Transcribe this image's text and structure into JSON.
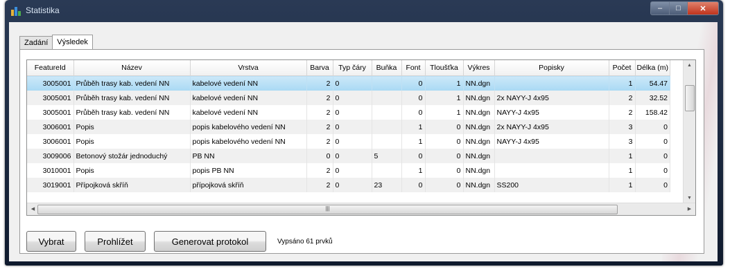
{
  "window": {
    "title": "Statistika",
    "icon": "app-icon"
  },
  "tabs": [
    {
      "label": "Zadání"
    },
    {
      "label": "Výsledek"
    }
  ],
  "table": {
    "columns": [
      "FeatureId",
      "Název",
      "Vrstva",
      "Barva",
      "Typ čáry",
      "Buňka",
      "Font",
      "Tloušťka",
      "Výkres",
      "Popisky",
      "Počet",
      "Délka (m)"
    ],
    "rows": [
      [
        "3005001",
        "Průběh trasy kab. vedení NN",
        "kabelové vedení NN",
        "2",
        "0",
        "",
        "0",
        "1",
        "NN.dgn",
        "",
        "1",
        "54.47"
      ],
      [
        "3005001",
        "Průběh trasy kab. vedení NN",
        "kabelové vedení NN",
        "2",
        "0",
        "",
        "0",
        "1",
        "NN.dgn",
        "2x NAYY-J 4x95",
        "2",
        "32.52"
      ],
      [
        "3005001",
        "Průběh trasy kab. vedení NN",
        "kabelové vedení NN",
        "2",
        "0",
        "",
        "0",
        "1",
        "NN.dgn",
        "NAYY-J 4x95",
        "2",
        "158.42"
      ],
      [
        "3006001",
        "Popis",
        "popis kabelového vedení NN",
        "2",
        "0",
        "",
        "1",
        "0",
        "NN.dgn",
        "2x NAYY-J 4x95",
        "3",
        "0"
      ],
      [
        "3006001",
        "Popis",
        "popis kabelového vedení NN",
        "2",
        "0",
        "",
        "1",
        "0",
        "NN.dgn",
        "NAYY-J 4x95",
        "3",
        "0"
      ],
      [
        "3009006",
        "Betonový stožár jednoduchý",
        "PB NN",
        "0",
        "0",
        "5",
        "0",
        "0",
        "NN.dgn",
        "",
        "1",
        "0"
      ],
      [
        "3010001",
        "Popis",
        "popis PB NN",
        "2",
        "0",
        "",
        "1",
        "0",
        "NN.dgn",
        "",
        "1",
        "0"
      ],
      [
        "3019001",
        "Přípojková skříň",
        "přípojková skříň",
        "2",
        "0",
        "23",
        "0",
        "0",
        "NN.dgn",
        "SS200",
        "1",
        "0"
      ]
    ],
    "selected_row": 0
  },
  "buttons": {
    "select": "Vybrat",
    "browse": "Prohlížet",
    "generate": "Generovat protokol"
  },
  "status": "Vypsáno 61 prvků",
  "colors": {
    "selection": "#a9d9f4",
    "close_button": "#c0331c"
  }
}
